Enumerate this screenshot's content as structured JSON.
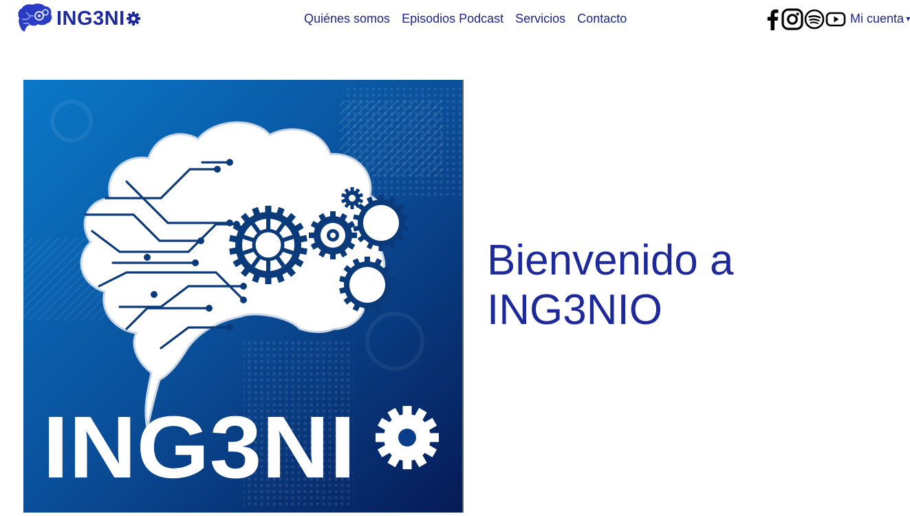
{
  "header": {
    "logo_text": "ING3NI",
    "nav": [
      "Quiénes somos",
      "Episodios Podcast",
      "Servicios",
      "Contacto"
    ],
    "social": [
      "facebook-icon",
      "instagram-icon",
      "spotify-icon",
      "youtube-icon"
    ],
    "account_label": "Mi cuenta"
  },
  "hero": {
    "image_text": "ING3NI",
    "headline_line1": "Bienvenido a",
    "headline_line2": "ING3NIO"
  },
  "colors": {
    "brand": "#1f2a9a",
    "nav_text": "#1c2688",
    "image_dark": "#0a2a6e",
    "image_light": "#0a6dc0"
  }
}
